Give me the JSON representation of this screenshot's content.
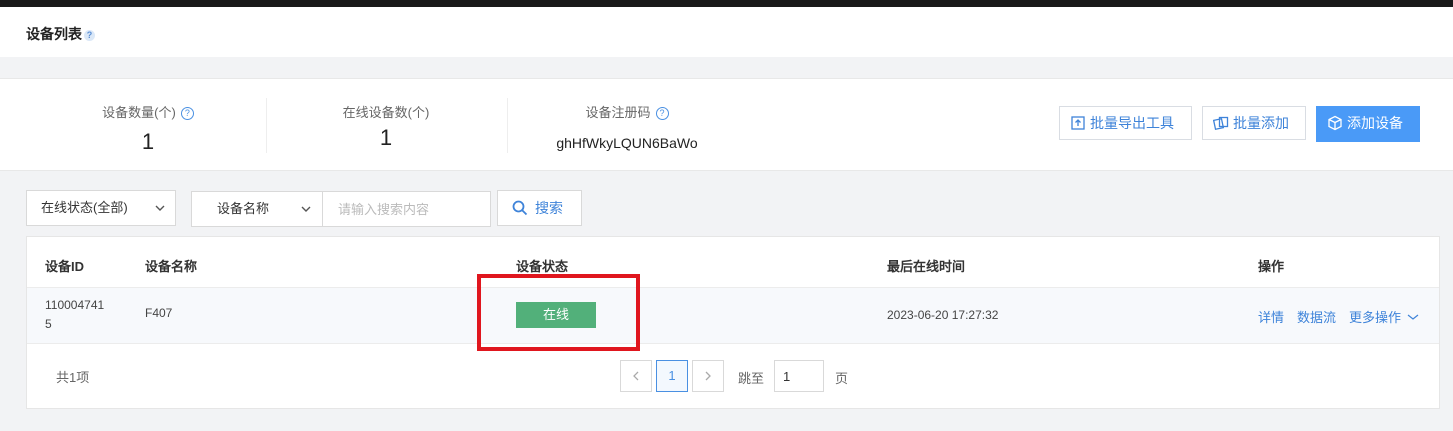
{
  "header": {
    "title": "设备列表",
    "help": "?"
  },
  "stats": {
    "device_count": {
      "label": "设备数量(个)",
      "value": "1"
    },
    "online_count": {
      "label": "在线设备数(个)",
      "value": "1"
    },
    "register_code": {
      "label": "设备注册码",
      "value": "ghHfWkyLQUN6BaWo"
    }
  },
  "actions": {
    "export_tool": "批量导出工具",
    "batch_add": "批量添加",
    "add_device": "添加设备"
  },
  "filters": {
    "status_select": "在线状态(全部)",
    "field_select": "设备名称",
    "search_placeholder": "请输入搜索内容",
    "search_button": "搜索"
  },
  "table": {
    "columns": [
      "设备ID",
      "设备名称",
      "设备状态",
      "最后在线时间",
      "操作"
    ],
    "rows": [
      {
        "device_id_line1": "110004741",
        "device_id_line2": "5",
        "name": "F407",
        "status": "在线",
        "last_online": "2023-06-20 17:27:32",
        "ops": [
          "详情",
          "数据流",
          "更多操作"
        ]
      }
    ]
  },
  "pagination": {
    "total": "共1项",
    "current_page": "1",
    "jump_label": "跳至",
    "jump_value": "1",
    "page_suffix": "页"
  },
  "colors": {
    "accent": "#4a9af7",
    "link": "#3e83d9",
    "online_badge": "#52b07a",
    "highlight": "#e0161e"
  }
}
